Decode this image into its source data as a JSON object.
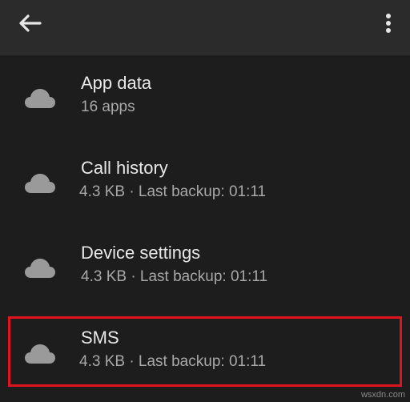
{
  "appbar": {
    "back_icon": "arrow-back-icon",
    "menu_icon": "more-vert-icon"
  },
  "backup_items": [
    {
      "title": "App data",
      "subtitle": "16 apps",
      "icon": "cloud-icon"
    },
    {
      "title": "Call history",
      "subtitle": "4.3 KB · Last backup: 01:11",
      "icon": "cloud-icon"
    },
    {
      "title": "Device settings",
      "subtitle": "4.3 KB · Last backup: 01:11",
      "icon": "cloud-icon"
    },
    {
      "title": "SMS",
      "subtitle": "4.3 KB · Last backup:  01:11",
      "icon": "cloud-icon"
    }
  ],
  "watermark": "wsxdn.com",
  "colors": {
    "background": "#1d1d1d",
    "appbar": "#2b2b2b",
    "highlight_border": "#e0141e",
    "icon": "#9a9a9a"
  }
}
